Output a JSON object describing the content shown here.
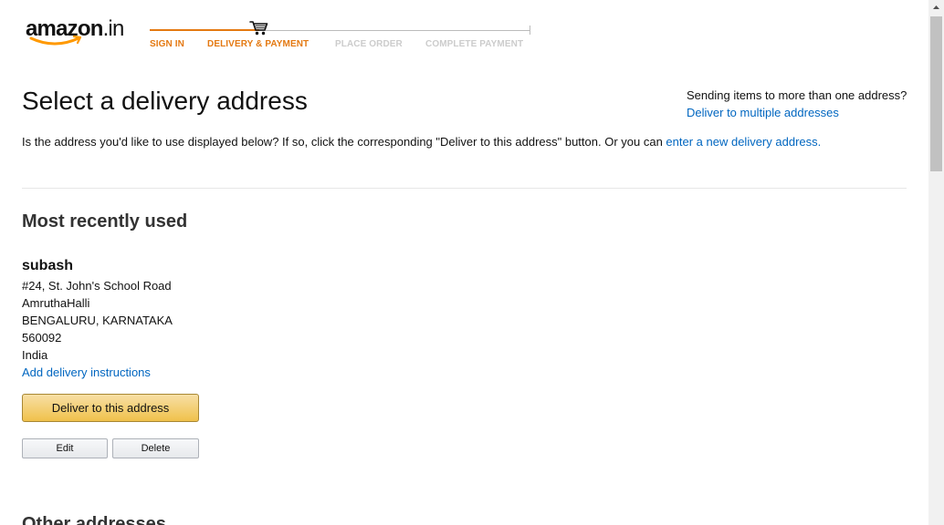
{
  "header": {
    "logo_text": "amazon",
    "logo_suffix": ".in",
    "cart_icon": "shopping-cart-icon",
    "accent_color": "#e47911",
    "steps": [
      {
        "label": "SIGN IN",
        "state": "done"
      },
      {
        "label": "DELIVERY & PAYMENT",
        "state": "current"
      },
      {
        "label": "PLACE ORDER",
        "state": "todo"
      },
      {
        "label": "COMPLETE PAYMENT",
        "state": "todo"
      }
    ]
  },
  "main": {
    "title": "Select a delivery address",
    "multi_question": "Sending items to more than one address?",
    "multi_link": "Deliver to multiple addresses",
    "intro_text": "Is the address you'd like to use displayed below? If so, click the corresponding \"Deliver to this address\" button. Or you can ",
    "intro_link": "enter a new delivery address.",
    "link_color": "#0066c0"
  },
  "recent": {
    "heading": "Most recently used",
    "address": {
      "name": "subash",
      "lines": [
        "#24, St. John's School Road",
        "AmruthaHalli",
        "BENGALURU, KARNATAKA",
        "560092",
        "India"
      ],
      "instructions_link": "Add delivery instructions"
    },
    "deliver_button": "Deliver to this address",
    "edit_button": "Edit",
    "delete_button": "Delete"
  },
  "other": {
    "heading": "Other addresses"
  }
}
